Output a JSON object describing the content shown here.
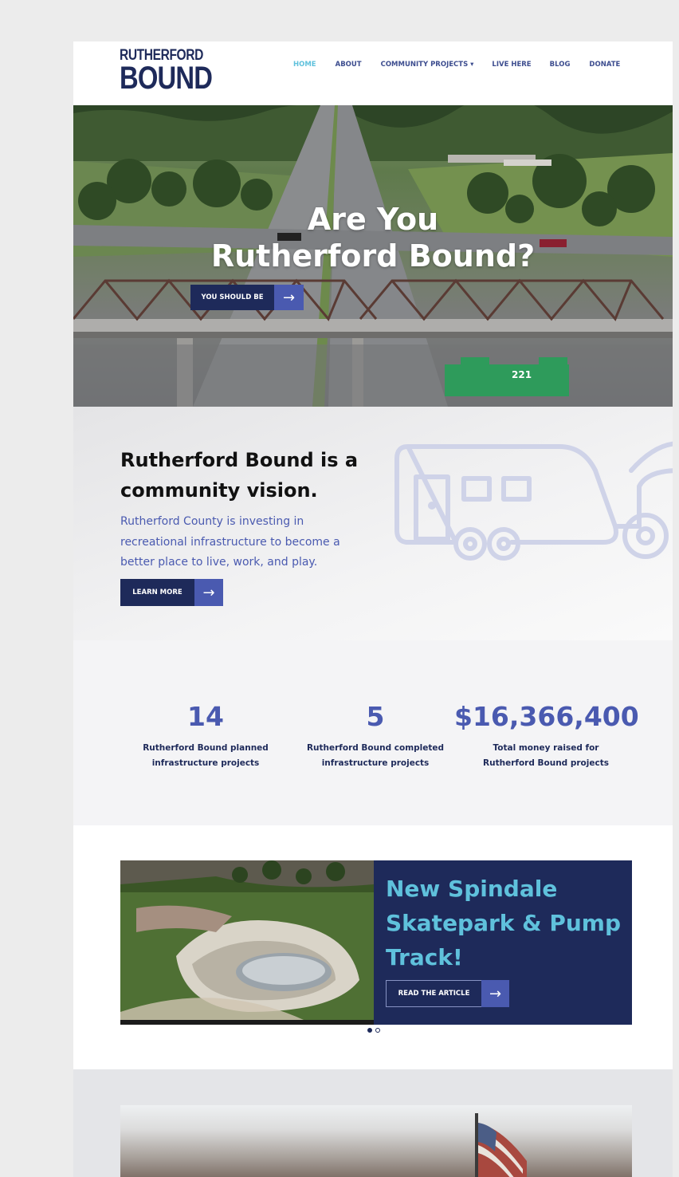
{
  "logo": {
    "line1": "RUTHERFORD",
    "line2": "BOUND"
  },
  "nav": {
    "items": [
      "HOME",
      "ABOUT",
      "COMMUNITY PROJECTS ▾",
      "LIVE HERE",
      "BLOG",
      "DONATE"
    ],
    "active": "HOME"
  },
  "hero": {
    "title_line1": "Are You",
    "title_line2": "Rutherford Bound?",
    "button_label": "YOU SHOULD BE",
    "sign_text": "221"
  },
  "vision": {
    "heading": "Rutherford Bound is a community vision.",
    "body": "Rutherford County is investing in recreational infrastructure to become a better place to live, work, and play.",
    "button_label": "LEARN MORE"
  },
  "stats": [
    {
      "value": "14",
      "label_line1": "Rutherford Bound planned",
      "label_line2": "infrastructure projects"
    },
    {
      "value": "5",
      "label_line1": "Rutherford Bound completed",
      "label_line2": "infrastructure projects"
    },
    {
      "value": "$16,366,400",
      "label_line1": "Total money raised for",
      "label_line2": "Rutherford Bound projects"
    }
  ],
  "featured": {
    "title": "New Spindale Skatepark & Pump Track!",
    "button_label": "READ THE ARTICLE"
  },
  "colors": {
    "navy": "#1e2a5a",
    "accent_blue": "#4a5ab0",
    "cyan": "#5fc1dc"
  }
}
